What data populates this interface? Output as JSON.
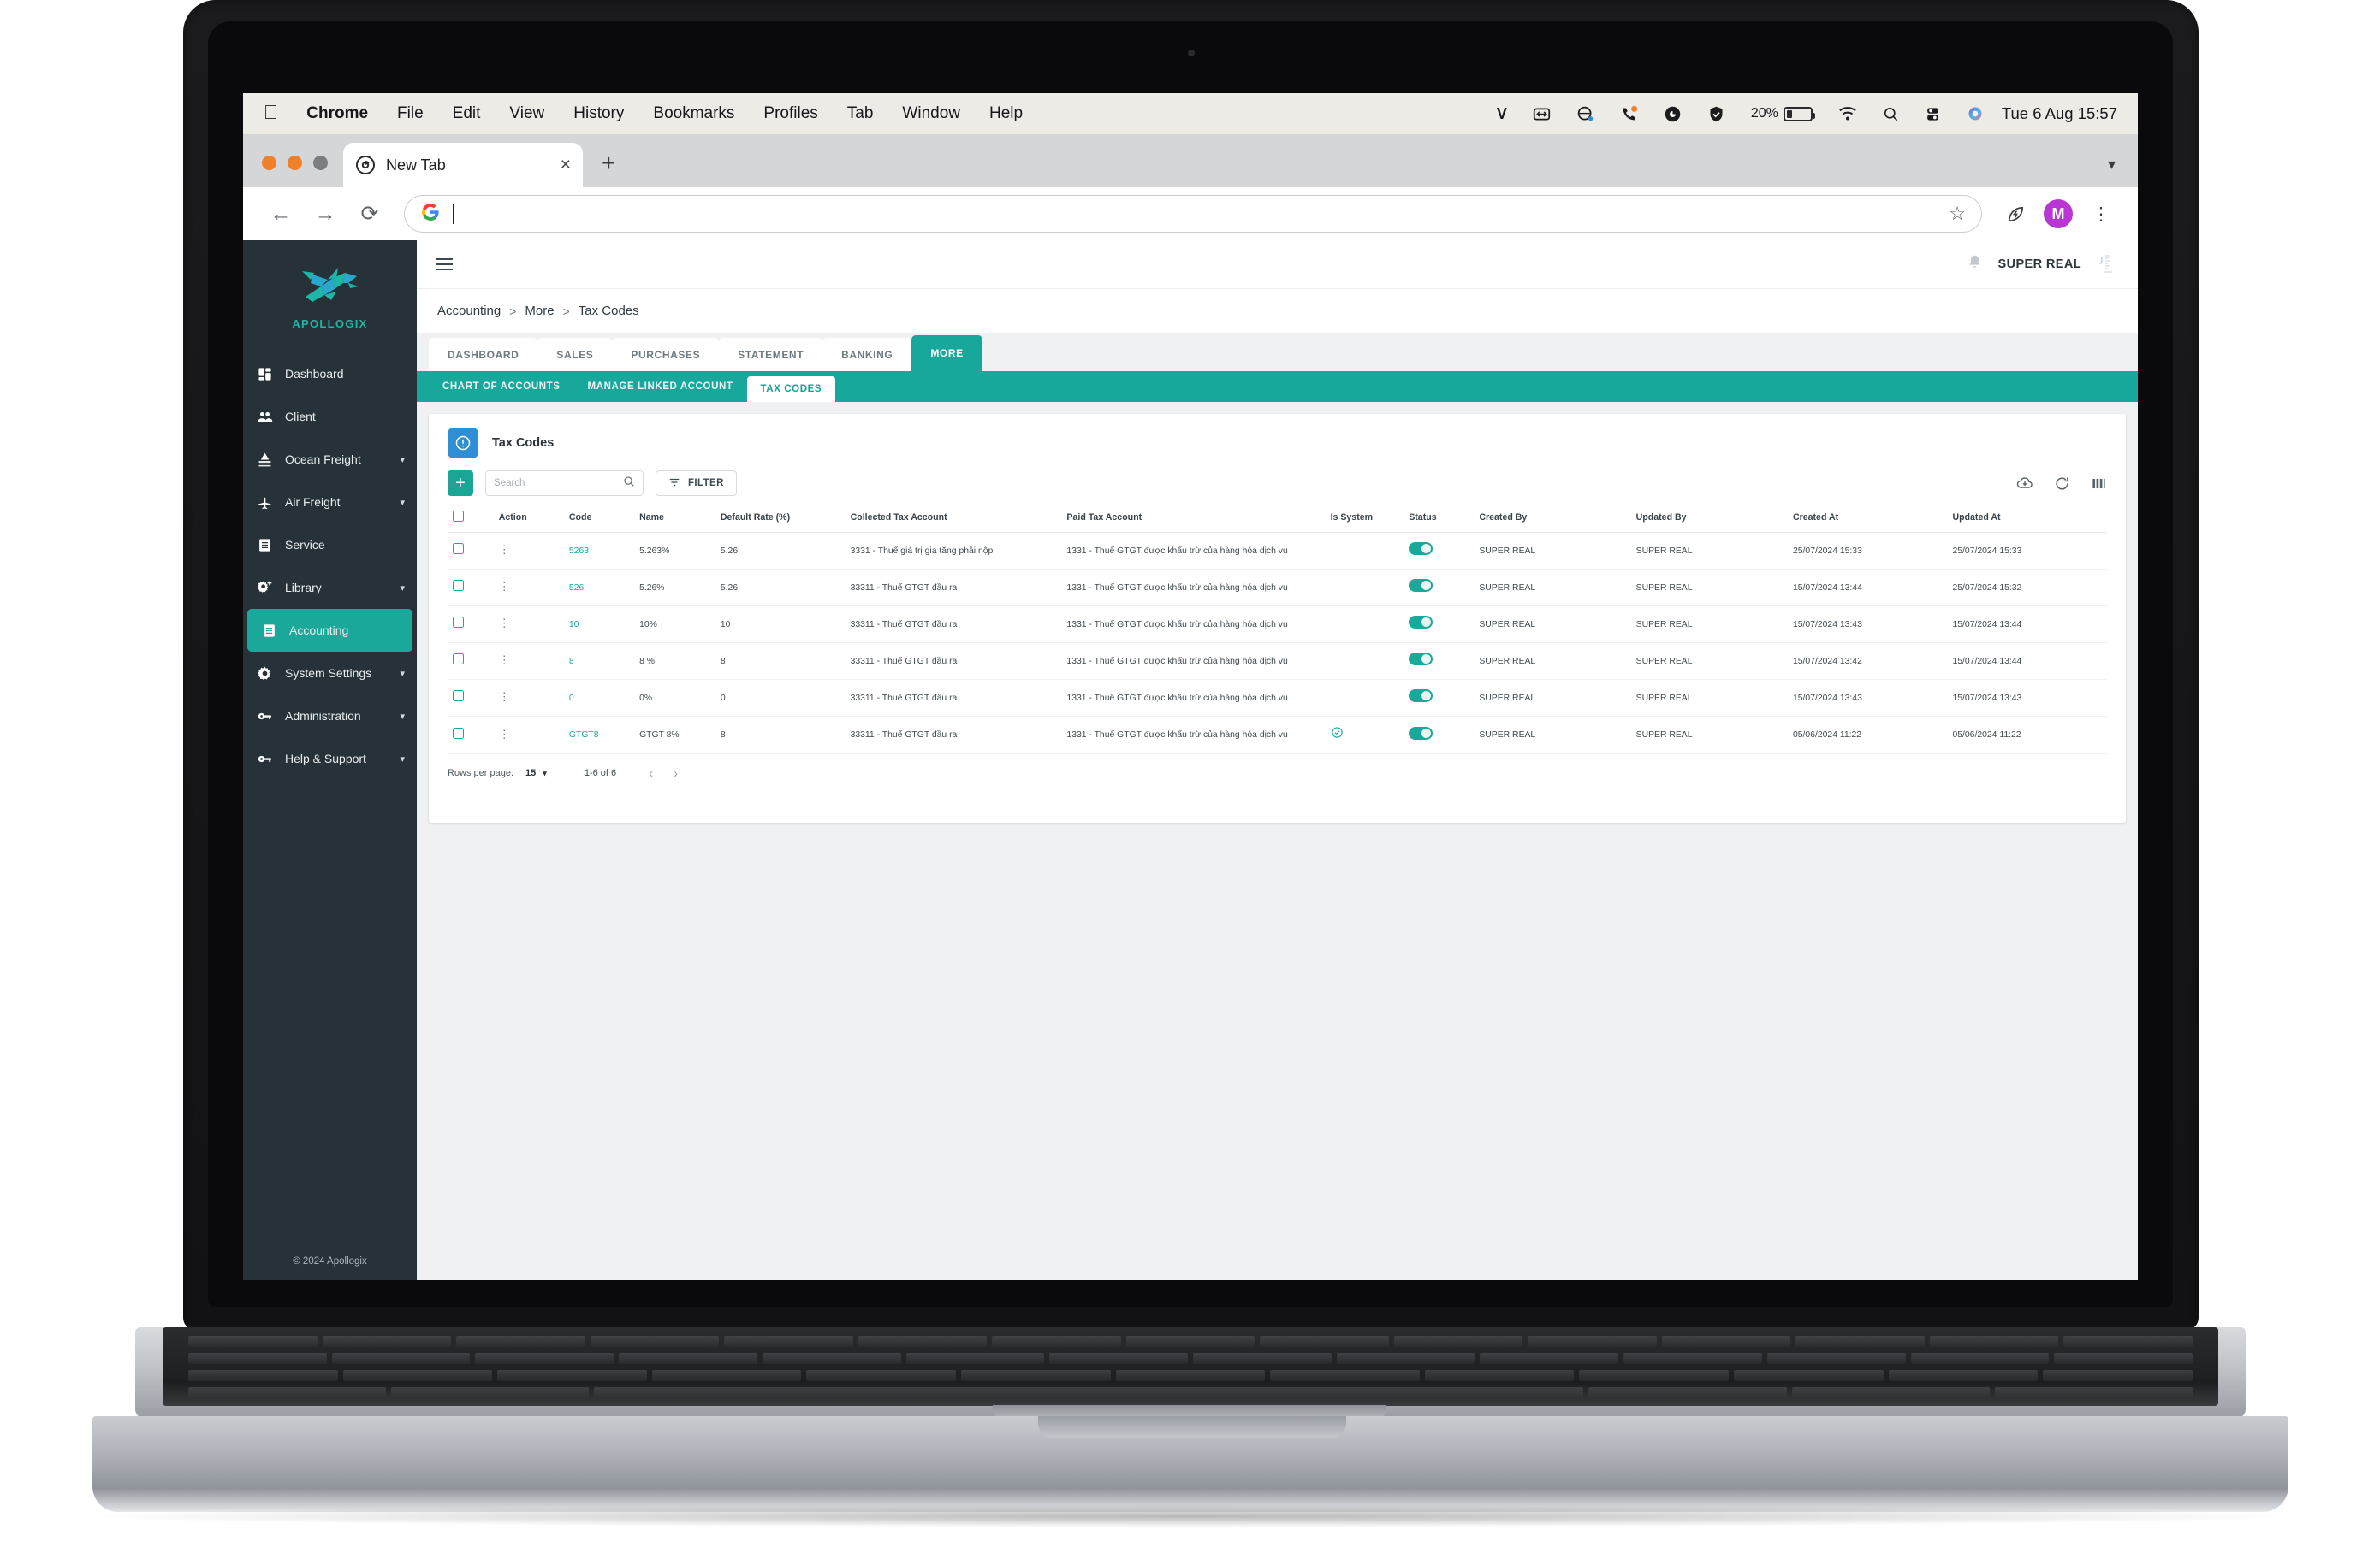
{
  "menubar": {
    "apple": "",
    "items": [
      "Chrome",
      "File",
      "Edit",
      "View",
      "History",
      "Bookmarks",
      "Profiles",
      "Tab",
      "Window",
      "Help"
    ],
    "status_icons": [
      "v-letter-icon",
      "expand-arrows-icon",
      "dropbox-icon",
      "phone-badge-icon",
      "grammarly-icon",
      "shield-check-icon"
    ],
    "battery_percent": "20%",
    "right_icons": [
      "wifi-icon",
      "search-icon",
      "control-center-icon",
      "siri-icon"
    ],
    "datetime": "Tue 6 Aug  15:57"
  },
  "browser": {
    "tab_title": "New Tab",
    "tab_close": "×",
    "new_tab": "+",
    "omnibox_value": "",
    "omnibox_placeholder": "",
    "profile_initial": "M"
  },
  "sidebar": {
    "logo_text": "APOLLOGIX",
    "items": [
      {
        "label": "Dashboard",
        "icon": "dashboard-icon",
        "expandable": false,
        "active": false
      },
      {
        "label": "Client",
        "icon": "people-icon",
        "expandable": false,
        "active": false
      },
      {
        "label": "Ocean Freight",
        "icon": "ship-icon",
        "expandable": true,
        "active": false
      },
      {
        "label": "Air Freight",
        "icon": "plane-icon",
        "expandable": true,
        "active": false
      },
      {
        "label": "Service",
        "icon": "list-icon",
        "expandable": false,
        "active": false
      },
      {
        "label": "Library",
        "icon": "gear-plus-icon",
        "expandable": true,
        "active": false
      },
      {
        "label": "Accounting",
        "icon": "ledger-icon",
        "expandable": false,
        "active": true
      },
      {
        "label": "System Settings",
        "icon": "gear-icon",
        "expandable": true,
        "active": false
      },
      {
        "label": "Administration",
        "icon": "key-icon",
        "expandable": true,
        "active": false
      },
      {
        "label": "Help & Support",
        "icon": "key-icon",
        "expandable": true,
        "active": false
      }
    ],
    "footer": "© 2024 Apollogix"
  },
  "appbar": {
    "username": "SUPER REAL"
  },
  "breadcrumb": {
    "root": "Accounting",
    "sep1": ">",
    "mid": "More",
    "sep2": ">",
    "leaf": "Tax Codes"
  },
  "primary_tabs": [
    {
      "label": "DASHBOARD",
      "active": false
    },
    {
      "label": "SALES",
      "active": false
    },
    {
      "label": "PURCHASES",
      "active": false
    },
    {
      "label": "STATEMENT",
      "active": false
    },
    {
      "label": "BANKING",
      "active": false
    },
    {
      "label": "MORE",
      "active": true
    }
  ],
  "secondary_tabs": [
    {
      "label": "CHART OF ACCOUNTS",
      "active": false
    },
    {
      "label": "MANAGE LINKED ACCOUNT",
      "active": false
    },
    {
      "label": "TAX CODES",
      "active": true
    }
  ],
  "panel": {
    "title": "Tax Codes",
    "badge_icon": "info-circle-icon",
    "add_label": "+",
    "search_placeholder": "Search",
    "search_value": "",
    "filter_label": "FILTER",
    "right_icons": [
      "cloud-download-icon",
      "refresh-icon",
      "columns-icon"
    ]
  },
  "table": {
    "columns": [
      "",
      "Action",
      "Code",
      "Name",
      "Default Rate (%)",
      "Collected Tax Account",
      "Paid Tax Account",
      "Is System",
      "Status",
      "Created By",
      "Updated By",
      "Created At",
      "Updated At"
    ],
    "rows": [
      {
        "code": "5263",
        "name": "5.263%",
        "rate": "5.26",
        "collected": "3331 - Thuế giá trị gia tăng phải nộp",
        "paid": "1331 - Thuế GTGT được khấu trừ của hàng hóa dịch vụ",
        "is_system": false,
        "status_on": true,
        "created_by": "SUPER REAL",
        "updated_by": "SUPER REAL",
        "created_at": "25/07/2024 15:33",
        "updated_at": "25/07/2024 15:33"
      },
      {
        "code": "526",
        "name": "5.26%",
        "rate": "5.26",
        "collected": "33311 - Thuế GTGT đầu ra",
        "paid": "1331 - Thuế GTGT được khấu trừ của hàng hóa dịch vụ",
        "is_system": false,
        "status_on": true,
        "created_by": "SUPER REAL",
        "updated_by": "SUPER REAL",
        "created_at": "15/07/2024 13:44",
        "updated_at": "25/07/2024 15:32"
      },
      {
        "code": "10",
        "name": "10%",
        "rate": "10",
        "collected": "33311 - Thuế GTGT đầu ra",
        "paid": "1331 - Thuế GTGT được khấu trừ của hàng hóa dịch vụ",
        "is_system": false,
        "status_on": true,
        "created_by": "SUPER REAL",
        "updated_by": "SUPER REAL",
        "created_at": "15/07/2024 13:43",
        "updated_at": "15/07/2024 13:44"
      },
      {
        "code": "8",
        "name": "8 %",
        "rate": "8",
        "collected": "33311 - Thuế GTGT đầu ra",
        "paid": "1331 - Thuế GTGT được khấu trừ của hàng hóa dịch vụ",
        "is_system": false,
        "status_on": true,
        "created_by": "SUPER REAL",
        "updated_by": "SUPER REAL",
        "created_at": "15/07/2024 13:42",
        "updated_at": "15/07/2024 13:44"
      },
      {
        "code": "0",
        "name": "0%",
        "rate": "0",
        "collected": "33311 - Thuế GTGT đầu ra",
        "paid": "1331 - Thuế GTGT được khấu trừ của hàng hóa dịch vụ",
        "is_system": false,
        "status_on": true,
        "created_by": "SUPER REAL",
        "updated_by": "SUPER REAL",
        "created_at": "15/07/2024 13:43",
        "updated_at": "15/07/2024 13:43"
      },
      {
        "code": "GTGT8",
        "name": "GTGT 8%",
        "rate": "8",
        "collected": "33311 - Thuế GTGT đầu ra",
        "paid": "1331 - Thuế GTGT được khấu trừ của hàng hóa dịch vụ",
        "is_system": true,
        "status_on": true,
        "created_by": "SUPER REAL",
        "updated_by": "SUPER REAL",
        "created_at": "05/06/2024 11:22",
        "updated_at": "05/06/2024 11:22"
      }
    ]
  },
  "pagination": {
    "rows_per_page_label": "Rows per page:",
    "rows_per_page_value": "15",
    "range": "1-6 of 6",
    "prev": "‹",
    "next": "›"
  },
  "colors": {
    "accent": "#18a89b",
    "sidebar_bg": "#263238",
    "badge_blue": "#2f8fd4",
    "link": "#1aa89a"
  }
}
